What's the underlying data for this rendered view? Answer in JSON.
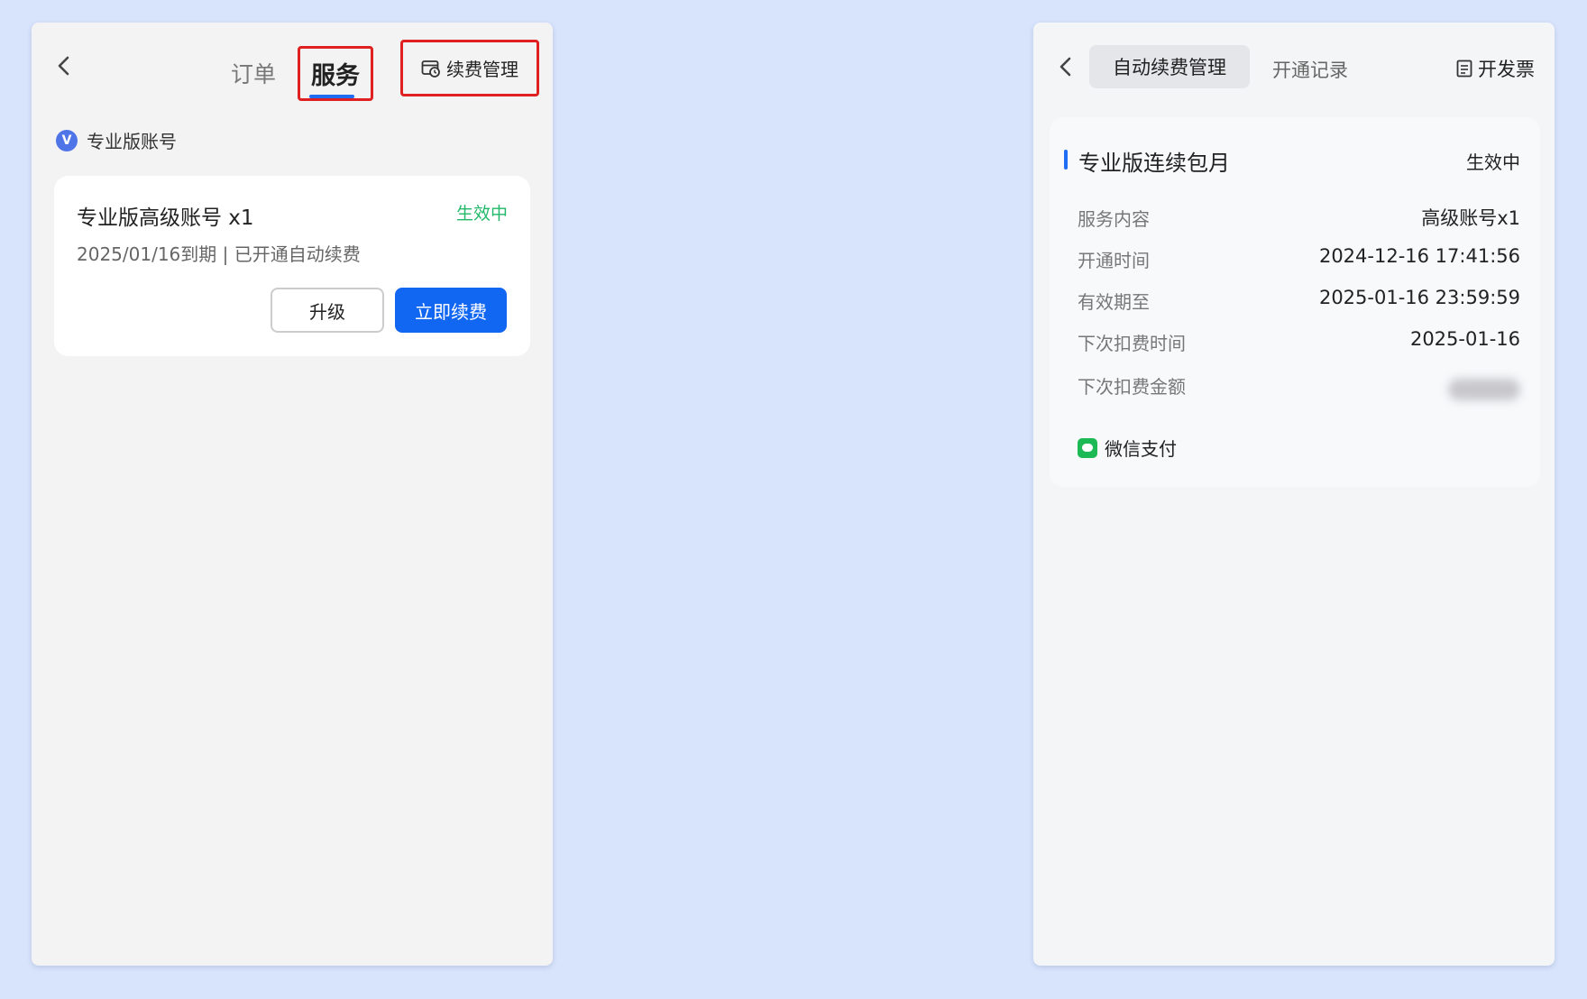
{
  "left": {
    "tabs": {
      "orders": "订单",
      "service": "服务"
    },
    "renew_management": "续费管理",
    "account_section": {
      "badge": "V",
      "label": "专业版账号"
    },
    "card": {
      "title": "专业版高级账号 x1",
      "status": "生效中",
      "subtitle": "2025/01/16到期 | 已开通自动续费",
      "upgrade_label": "升级",
      "renew_now_label": "立即续费"
    }
  },
  "right": {
    "tabs": {
      "auto_renew": "自动续费管理",
      "records": "开通记录"
    },
    "invoice_label": "开发票",
    "detail": {
      "title": "专业版连续包月",
      "status": "生效中",
      "rows": [
        {
          "label": "服务内容",
          "value": "高级账号x1"
        },
        {
          "label": "开通时间",
          "value": "2024-12-16 17:41:56"
        },
        {
          "label": "有效期至",
          "value": "2025-01-16 23:59:59"
        },
        {
          "label": "下次扣费时间",
          "value": "2025-01-16"
        },
        {
          "label": "下次扣费金额",
          "value": ""
        }
      ],
      "payment_method": "微信支付"
    }
  },
  "colors": {
    "background": "#d8e4fc",
    "accent_blue": "#1167f2",
    "status_green": "#22b86a",
    "highlight_red": "#e02020"
  }
}
